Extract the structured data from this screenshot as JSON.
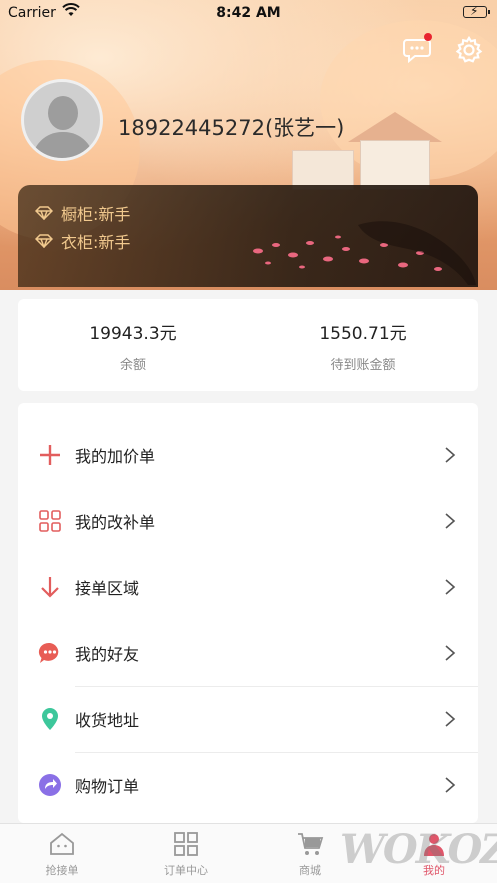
{
  "status_bar": {
    "carrier": "Carrier",
    "time": "8:42 AM"
  },
  "header": {
    "username": "18922445272(张艺一)",
    "message_icon": "chat-bubble-icon",
    "settings_icon": "gear-icon",
    "has_unread": true
  },
  "levels": [
    {
      "label": "橱柜:新手",
      "icon": "diamond-icon"
    },
    {
      "label": "衣柜:新手",
      "icon": "diamond-icon"
    }
  ],
  "balance": {
    "available_value": "19943.3元",
    "available_label": "余额",
    "pending_value": "1550.71元",
    "pending_label": "待到账金额"
  },
  "menu": [
    {
      "label": "我的加价单",
      "icon": "plus-icon",
      "color": "#e25d5d"
    },
    {
      "label": "我的改补单",
      "icon": "grid-icon",
      "color": "#e25d5d"
    },
    {
      "label": "接单区域",
      "icon": "arrow-down-icon",
      "color": "#e25d5d"
    },
    {
      "label": "我的好友",
      "icon": "chat-dots-icon",
      "color": "#e85d55"
    },
    {
      "label": "收货地址",
      "icon": "location-pin-icon",
      "color": "#3dc79b"
    },
    {
      "label": "购物订单",
      "icon": "share-arrow-icon",
      "color": "#8a70e6"
    }
  ],
  "tabs": [
    {
      "label": "抢接单",
      "icon": "home-icon"
    },
    {
      "label": "订单中心",
      "icon": "grid-icon"
    },
    {
      "label": "商城",
      "icon": "cart-icon"
    },
    {
      "label": "我的",
      "icon": "user-icon",
      "active": true
    }
  ],
  "colors": {
    "accent": "#e0566a",
    "level_text": "#f1c98e"
  },
  "watermark": "WOKOZ"
}
